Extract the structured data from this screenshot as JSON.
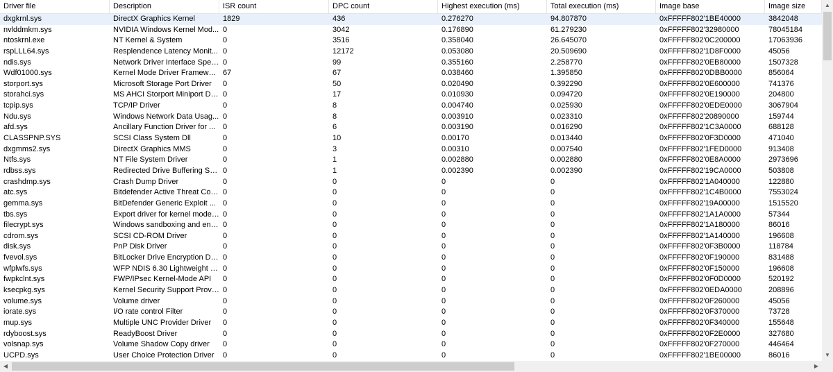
{
  "table": {
    "columns": [
      "Driver file",
      "Description",
      "ISR count",
      "DPC count",
      "Highest execution (ms)",
      "Total execution (ms)",
      "Image base",
      "Image size"
    ],
    "selected_row": 0,
    "rows": [
      [
        "dxgkrnl.sys",
        "DirectX Graphics Kernel",
        "1829",
        "436",
        "0.276270",
        "94.807870",
        "0xFFFFF802'1BE40000",
        "3842048"
      ],
      [
        "nvlddmkm.sys",
        "NVIDIA Windows Kernel Mod...",
        "0",
        "3042",
        "0.176890",
        "61.279230",
        "0xFFFFF802'32980000",
        "78045184"
      ],
      [
        "ntoskrnl.exe",
        "NT Kernel & System",
        "0",
        "3516",
        "0.358040",
        "26.645070",
        "0xFFFFF802'0C200000",
        "17063936"
      ],
      [
        "rspLLL64.sys",
        "Resplendence Latency Monit...",
        "0",
        "12172",
        "0.053080",
        "20.509690",
        "0xFFFFF802'1D8F0000",
        "45056"
      ],
      [
        "ndis.sys",
        "Network Driver Interface Speci...",
        "0",
        "99",
        "0.355160",
        "2.258770",
        "0xFFFFF802'0EB80000",
        "1507328"
      ],
      [
        "Wdf01000.sys",
        "Kernel Mode Driver Framewor...",
        "67",
        "67",
        "0.038460",
        "1.395850",
        "0xFFFFF802'0DBB0000",
        "856064"
      ],
      [
        "storport.sys",
        "Microsoft Storage Port Driver",
        "0",
        "50",
        "0.020490",
        "0.392290",
        "0xFFFFF802'0E600000",
        "741376"
      ],
      [
        "storahci.sys",
        "MS AHCI Storport Miniport Dri...",
        "0",
        "17",
        "0.010930",
        "0.094720",
        "0xFFFFF802'0E190000",
        "204800"
      ],
      [
        "tcpip.sys",
        "TCP/IP Driver",
        "0",
        "8",
        "0.004740",
        "0.025930",
        "0xFFFFF802'0EDE0000",
        "3067904"
      ],
      [
        "Ndu.sys",
        "Windows Network Data Usag...",
        "0",
        "8",
        "0.003910",
        "0.023310",
        "0xFFFFF802'20890000",
        "159744"
      ],
      [
        "afd.sys",
        "Ancillary Function Driver for ...",
        "0",
        "6",
        "0.003190",
        "0.016290",
        "0xFFFFF802'1C3A0000",
        "688128"
      ],
      [
        "CLASSPNP.SYS",
        "SCSI Class System Dll",
        "0",
        "10",
        "0.00170",
        "0.013440",
        "0xFFFFF802'0F3D0000",
        "471040"
      ],
      [
        "dxgmms2.sys",
        "DirectX Graphics MMS",
        "0",
        "3",
        "0.00310",
        "0.007540",
        "0xFFFFF802'1FED0000",
        "913408"
      ],
      [
        "Ntfs.sys",
        "NT File System Driver",
        "0",
        "1",
        "0.002880",
        "0.002880",
        "0xFFFFF802'0E8A0000",
        "2973696"
      ],
      [
        "rdbss.sys",
        "Redirected Drive Buffering Su...",
        "0",
        "1",
        "0.002390",
        "0.002390",
        "0xFFFFF802'19CA0000",
        "503808"
      ],
      [
        "crashdmp.sys",
        "Crash Dump Driver",
        "0",
        "0",
        "0",
        "0",
        "0xFFFFF802'1A040000",
        "122880"
      ],
      [
        "atc.sys",
        "Bitdefender Active Threat Cont...",
        "0",
        "0",
        "0",
        "0",
        "0xFFFFF802'1C4B0000",
        "7553024"
      ],
      [
        "gemma.sys",
        "BitDefender Generic Exploit ...",
        "0",
        "0",
        "0",
        "0",
        "0xFFFFF802'19A00000",
        "1515520"
      ],
      [
        "tbs.sys",
        "Export driver for kernel mode ...",
        "0",
        "0",
        "0",
        "0",
        "0xFFFFF802'1A1A0000",
        "57344"
      ],
      [
        "filecrypt.sys",
        "Windows sandboxing and enc...",
        "0",
        "0",
        "0",
        "0",
        "0xFFFFF802'1A180000",
        "86016"
      ],
      [
        "cdrom.sys",
        "SCSI CD-ROM Driver",
        "0",
        "0",
        "0",
        "0",
        "0xFFFFF802'1A140000",
        "196608"
      ],
      [
        "disk.sys",
        "PnP Disk Driver",
        "0",
        "0",
        "0",
        "0",
        "0xFFFFF802'0F3B0000",
        "118784"
      ],
      [
        "fvevol.sys",
        "BitLocker Drive Encryption Dri...",
        "0",
        "0",
        "0",
        "0",
        "0xFFFFF802'0F190000",
        "831488"
      ],
      [
        "wfplwfs.sys",
        "WFP NDIS 6.30 Lightweight F...",
        "0",
        "0",
        "0",
        "0",
        "0xFFFFF802'0F150000",
        "196608"
      ],
      [
        "fwpkclnt.sys",
        "FWP/IPsec Kernel-Mode API",
        "0",
        "0",
        "0",
        "0",
        "0xFFFFF802'0F0D0000",
        "520192"
      ],
      [
        "ksecpkg.sys",
        "Kernel Security Support Provi...",
        "0",
        "0",
        "0",
        "0",
        "0xFFFFF802'0EDA0000",
        "208896"
      ],
      [
        "volume.sys",
        "Volume driver",
        "0",
        "0",
        "0",
        "0",
        "0xFFFFF802'0F260000",
        "45056"
      ],
      [
        "iorate.sys",
        "I/O rate control Filter",
        "0",
        "0",
        "0",
        "0",
        "0xFFFFF802'0F370000",
        "73728"
      ],
      [
        "mup.sys",
        "Multiple UNC Provider Driver",
        "0",
        "0",
        "0",
        "0",
        "0xFFFFF802'0F340000",
        "155648"
      ],
      [
        "rdyboost.sys",
        "ReadyBoost Driver",
        "0",
        "0",
        "0",
        "0",
        "0xFFFFF802'0F2E0000",
        "327680"
      ],
      [
        "volsnap.sys",
        "Volume Shadow Copy driver",
        "0",
        "0",
        "0",
        "0",
        "0xFFFFF802'0F270000",
        "446464"
      ],
      [
        "UCPD.sys",
        "User Choice Protection Driver",
        "0",
        "0",
        "0",
        "0",
        "0xFFFFF802'1BE00000",
        "86016"
      ]
    ]
  },
  "scrollbars": {
    "up_icon": "arrow-up-icon",
    "down_icon": "arrow-down-icon",
    "left_icon": "arrow-left-icon",
    "right_icon": "arrow-right-icon"
  },
  "colors": {
    "selected_row": "#e8f1fb",
    "grid_line": "#e5e5e5",
    "scrollbar_track": "#f0f0f0",
    "scrollbar_thumb": "#cdcdcd"
  }
}
